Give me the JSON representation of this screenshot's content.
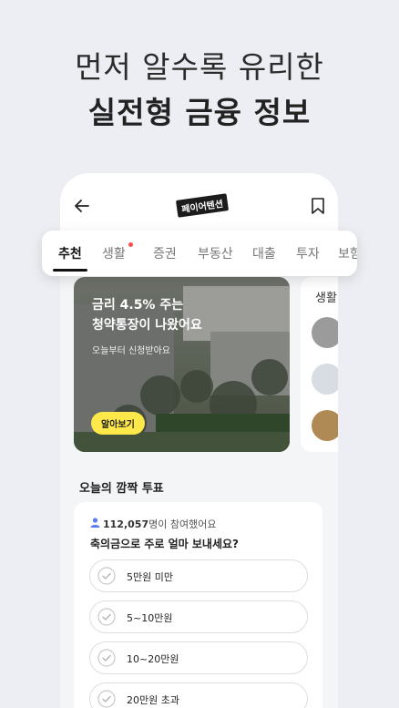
{
  "promo": {
    "line1": "먼저 알수록 유리한",
    "line2": "실전형 금융 정보"
  },
  "header": {
    "logo_text": "페이어텐션",
    "icons": [
      "back-arrow-icon",
      "bookmark-icon"
    ]
  },
  "tabs": [
    {
      "label": "추천",
      "active": true
    },
    {
      "label": "생활",
      "badge": true
    },
    {
      "label": "증권"
    },
    {
      "label": "부동산"
    },
    {
      "label": "대출"
    },
    {
      "label": "투자"
    },
    {
      "label": "보험"
    }
  ],
  "feature": {
    "title_line1": "금리 4.5% 주는",
    "title_line2": "청약통장이 나왔어요",
    "subtitle": "오늘부터 신청받아요",
    "button": "알아보기"
  },
  "side_card": {
    "title": "생활"
  },
  "poll": {
    "section_title": "오늘의 깜짝 투표",
    "participants_number": "112,057",
    "participants_suffix": "명이 참여했어요",
    "question": "축의금으로 주로 얼마 보내세요?",
    "options": [
      "5만원 미만",
      "5~10만원",
      "10~20만원",
      "20만원 초과"
    ]
  },
  "colors": {
    "accent_yellow": "#ffe94a",
    "badge_red": "#ff4b4b",
    "background": "#eceef3",
    "user_icon_blue": "#5b7cf0"
  }
}
